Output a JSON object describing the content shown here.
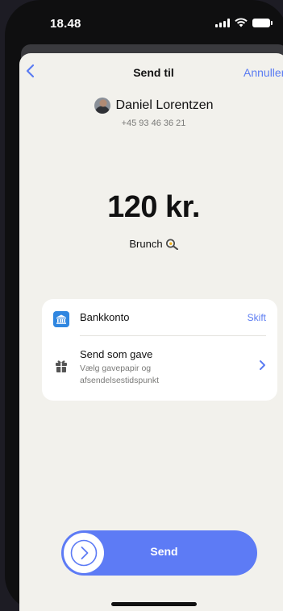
{
  "status_bar": {
    "time": "18.48"
  },
  "nav": {
    "title": "Send til",
    "cancel_label": "Annuller",
    "back_icon": "chevron-left-icon"
  },
  "recipient": {
    "name": "Daniel Lorentzen",
    "phone": "+45 93 46 36 21"
  },
  "payment": {
    "amount": "120 kr.",
    "note": "Brunch",
    "note_icon": "frying-pan-egg-icon"
  },
  "options": {
    "bank": {
      "label": "Bankkonto",
      "action": "Skift",
      "icon": "bank-icon"
    },
    "gift": {
      "title": "Send som gave",
      "subtitle": "Vælg gavepapir og afsendelsestidspunkt",
      "icon": "gift-icon"
    }
  },
  "send": {
    "label": "Send"
  },
  "colors": {
    "accent": "#5b7cf2",
    "background": "#f2f1ec",
    "bank_icon": "#2f86e0"
  }
}
